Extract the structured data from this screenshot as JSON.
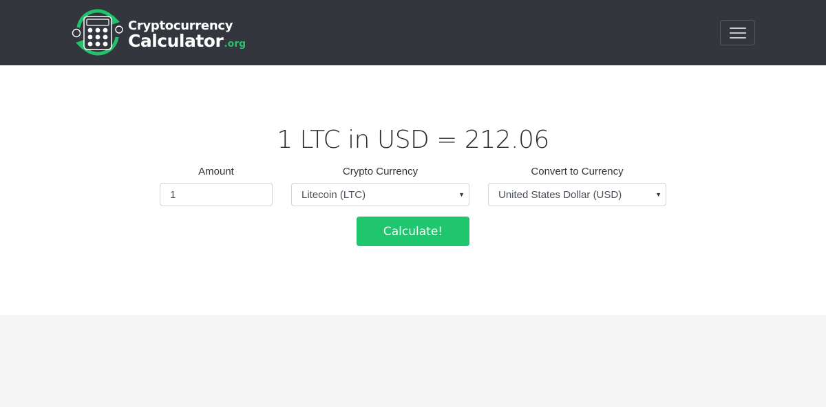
{
  "header": {
    "logo": {
      "line1": "Cryptocurrency",
      "line2": "Calculator",
      "suffix": ".org",
      "icon": "calculator-cycle-icon",
      "accent": "#22c36a"
    },
    "menu_icon": "hamburger-menu-icon",
    "background": "#33373d"
  },
  "result": {
    "text": "1 LTC in USD = 212.06"
  },
  "form": {
    "amount": {
      "label": "Amount",
      "value": "1"
    },
    "crypto": {
      "label": "Crypto Currency",
      "selected": "Litecoin (LTC)"
    },
    "convert": {
      "label": "Convert to Currency",
      "selected": "United States Dollar (USD)"
    },
    "submit_label": "Calculate!",
    "button_color": "#1fc66e"
  }
}
